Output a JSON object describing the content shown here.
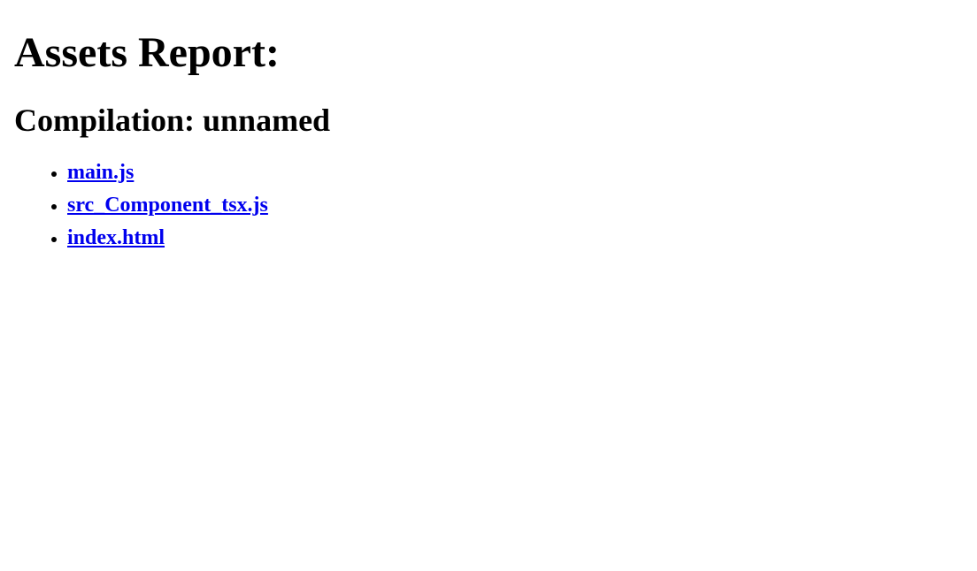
{
  "page": {
    "title": "Assets Report:",
    "compilation_label": "Compilation: unnamed"
  },
  "assets": [
    {
      "name": "main.js"
    },
    {
      "name": "src_Component_tsx.js"
    },
    {
      "name": "index.html"
    }
  ]
}
